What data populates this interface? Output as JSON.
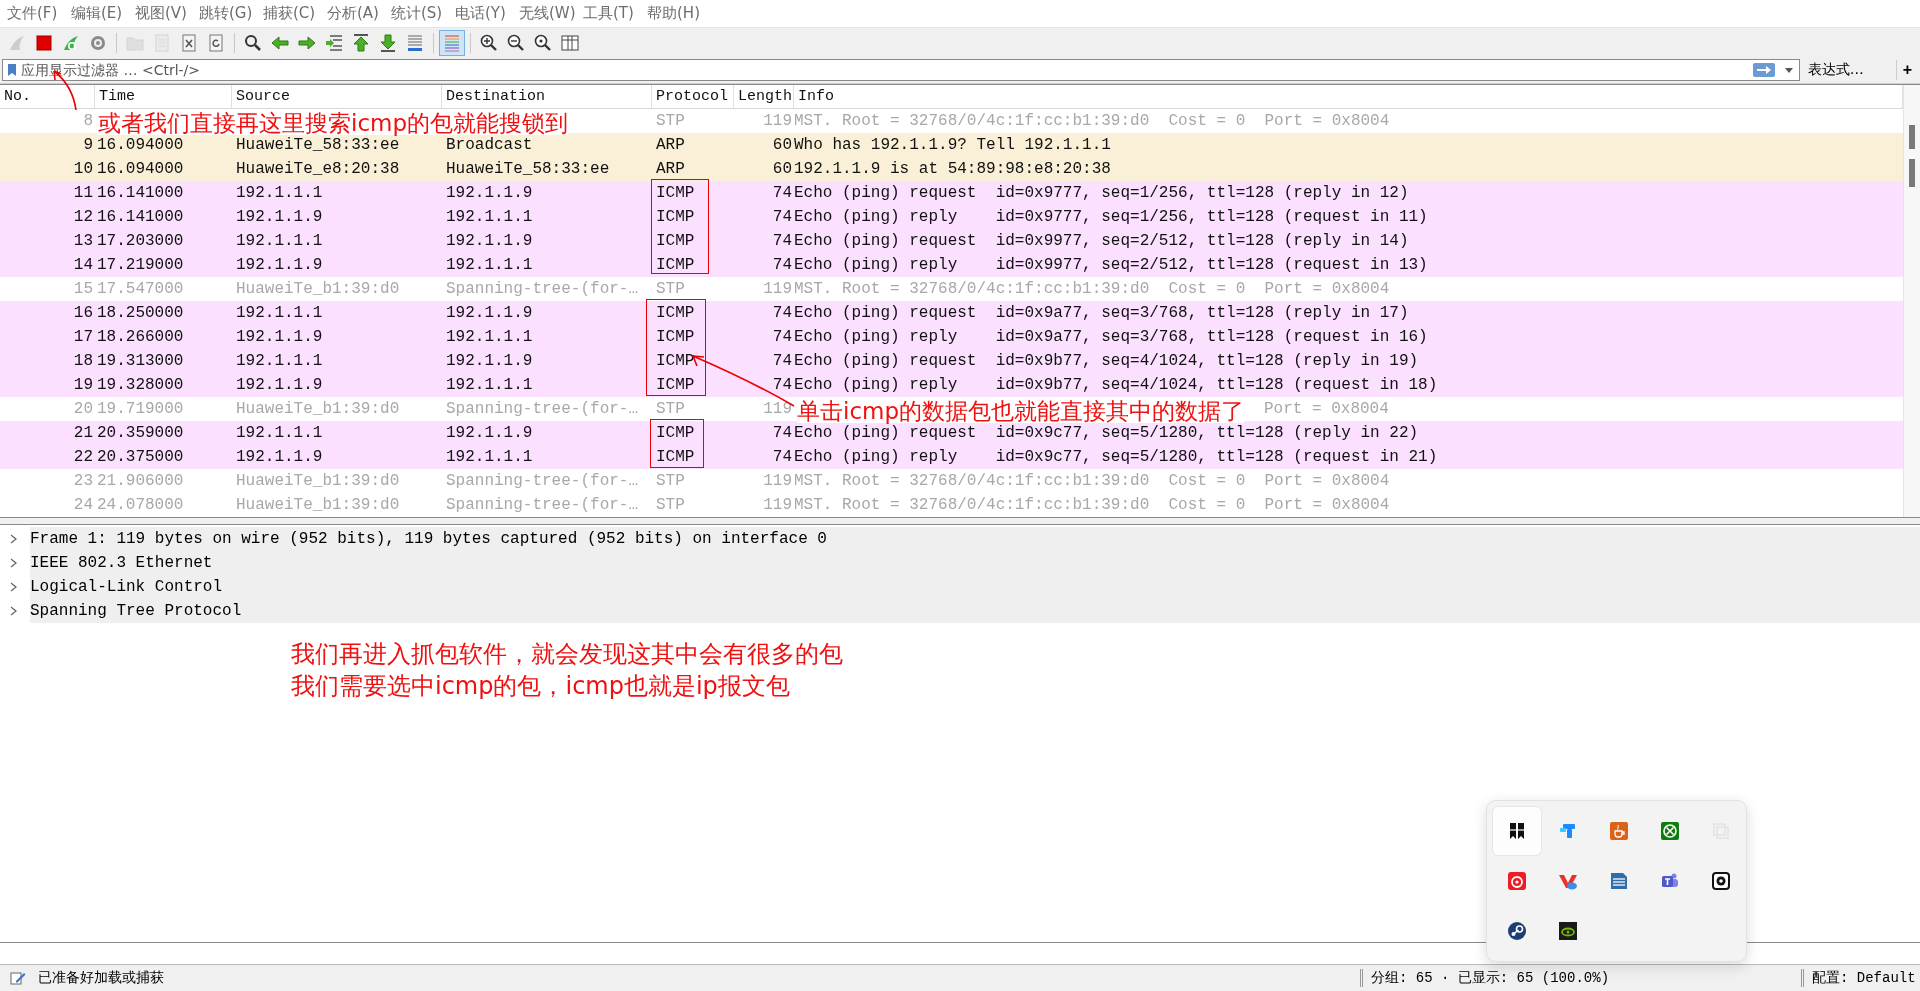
{
  "menu": [
    "文件(F)",
    "编辑(E)",
    "视图(V)",
    "跳转(G)",
    "捕获(C)",
    "分析(A)",
    "统计(S)",
    "电话(Y)",
    "无线(W)",
    "工具(T)",
    "帮助(H)"
  ],
  "toolbar": [
    {
      "kind": "shark-fin",
      "disabled": true,
      "on": false
    },
    {
      "kind": "stop",
      "disabled": false,
      "on": false
    },
    {
      "kind": "restart",
      "disabled": false,
      "on": false
    },
    {
      "kind": "options",
      "disabled": false,
      "on": false
    },
    {
      "kind": "separator"
    },
    {
      "kind": "open",
      "disabled": true,
      "on": false
    },
    {
      "kind": "save",
      "disabled": true,
      "on": false
    },
    {
      "kind": "close",
      "disabled": false,
      "on": false
    },
    {
      "kind": "reload",
      "disabled": false,
      "on": false
    },
    {
      "kind": "separator"
    },
    {
      "kind": "find",
      "disabled": false,
      "on": false
    },
    {
      "kind": "back",
      "disabled": false,
      "on": false
    },
    {
      "kind": "forward",
      "disabled": false,
      "on": false
    },
    {
      "kind": "goto",
      "disabled": false,
      "on": false
    },
    {
      "kind": "first",
      "disabled": false,
      "on": false
    },
    {
      "kind": "last",
      "disabled": false,
      "on": false
    },
    {
      "kind": "autoscroll",
      "disabled": false,
      "on": false
    },
    {
      "kind": "separator"
    },
    {
      "kind": "colorize",
      "disabled": false,
      "on": true
    },
    {
      "kind": "separator"
    },
    {
      "kind": "zoom-in",
      "disabled": false,
      "on": false
    },
    {
      "kind": "zoom-out",
      "disabled": false,
      "on": false
    },
    {
      "kind": "zoom-reset",
      "disabled": false,
      "on": false
    },
    {
      "kind": "resize",
      "disabled": false,
      "on": false
    }
  ],
  "filter": {
    "placeholder": "应用显示过滤器 … <Ctrl-/>",
    "expression_button": "表达式…",
    "add_button": "+"
  },
  "packet_list": {
    "columns": [
      "No.",
      "Time",
      "Source",
      "Destination",
      "Protocol",
      "Length",
      "Info"
    ],
    "rows": [
      {
        "no": "8",
        "protocol": "STP",
        "length": "119",
        "info": "MST. Root = 32768/0/4c:1f:cc:b1:39:d0  Cost = 0  Port = 0x8004",
        "color": "#ffffff",
        "dimmed": true
      },
      {
        "no": "9",
        "time": "16.094000",
        "source": "HuaweiTe_58:33:ee",
        "destination": "Broadcast",
        "protocol": "ARP",
        "length": "60",
        "info": "Who has 192.1.1.9? Tell 192.1.1.1",
        "color": "#faf0d7",
        "dimmed": false
      },
      {
        "no": "10",
        "time": "16.094000",
        "source": "HuaweiTe_e8:20:38",
        "destination": "HuaweiTe_58:33:ee",
        "protocol": "ARP",
        "length": "60",
        "info": "192.1.1.9 is at 54:89:98:e8:20:38",
        "color": "#faf0d7",
        "dimmed": false
      },
      {
        "no": "11",
        "time": "16.141000",
        "source": "192.1.1.1",
        "destination": "192.1.1.9",
        "protocol": "ICMP",
        "length": "74",
        "info": "Echo (ping) request  id=0x9777, seq=1/256, ttl=128 (reply in 12)",
        "color": "#fce0ff",
        "dimmed": false
      },
      {
        "no": "12",
        "time": "16.141000",
        "source": "192.1.1.9",
        "destination": "192.1.1.1",
        "protocol": "ICMP",
        "length": "74",
        "info": "Echo (ping) reply    id=0x9777, seq=1/256, ttl=128 (request in 11)",
        "color": "#fce0ff",
        "dimmed": false
      },
      {
        "no": "13",
        "time": "17.203000",
        "source": "192.1.1.1",
        "destination": "192.1.1.9",
        "protocol": "ICMP",
        "length": "74",
        "info": "Echo (ping) request  id=0x9977, seq=2/512, ttl=128 (reply in 14)",
        "color": "#fce0ff",
        "dimmed": false
      },
      {
        "no": "14",
        "time": "17.219000",
        "source": "192.1.1.9",
        "destination": "192.1.1.1",
        "protocol": "ICMP",
        "length": "74",
        "info": "Echo (ping) reply    id=0x9977, seq=2/512, ttl=128 (request in 13)",
        "color": "#fce0ff",
        "dimmed": false
      },
      {
        "no": "15",
        "time": "17.547000",
        "source": "HuaweiTe_b1:39:d0",
        "destination": "Spanning-tree-(for-…",
        "protocol": "STP",
        "length": "119",
        "info": "MST. Root = 32768/0/4c:1f:cc:b1:39:d0  Cost = 0  Port = 0x8004",
        "color": "#ffffff",
        "dimmed": true
      },
      {
        "no": "16",
        "time": "18.250000",
        "source": "192.1.1.1",
        "destination": "192.1.1.9",
        "protocol": "ICMP",
        "length": "74",
        "info": "Echo (ping) request  id=0x9a77, seq=3/768, ttl=128 (reply in 17)",
        "color": "#fce0ff",
        "dimmed": false
      },
      {
        "no": "17",
        "time": "18.266000",
        "source": "192.1.1.9",
        "destination": "192.1.1.1",
        "protocol": "ICMP",
        "length": "74",
        "info": "Echo (ping) reply    id=0x9a77, seq=3/768, ttl=128 (request in 16)",
        "color": "#fce0ff",
        "dimmed": false
      },
      {
        "no": "18",
        "time": "19.313000",
        "source": "192.1.1.1",
        "destination": "192.1.1.9",
        "protocol": "ICMP",
        "length": "74",
        "info": "Echo (ping) request  id=0x9b77, seq=4/1024, ttl=128 (reply in 19)",
        "color": "#fce0ff",
        "dimmed": false
      },
      {
        "no": "19",
        "time": "19.328000",
        "source": "192.1.1.9",
        "destination": "192.1.1.1",
        "protocol": "ICMP",
        "length": "74",
        "info": "Echo (ping) reply    id=0x9b77, seq=4/1024, ttl=128 (request in 18)",
        "color": "#fce0ff",
        "dimmed": false
      },
      {
        "no": "20",
        "time": "19.719000",
        "source": "HuaweiTe_b1:39:d0",
        "destination": "Spanning-tree-(for-…",
        "protocol": "STP",
        "length": "119",
        "info": "Port = 0x8004",
        "color": "#ffffff",
        "dimmed": true
      },
      {
        "no": "21",
        "time": "20.359000",
        "source": "192.1.1.1",
        "destination": "192.1.1.9",
        "protocol": "ICMP",
        "length": "74",
        "info": "Echo (ping) request  id=0x9c77, seq=5/1280, ttl=128 (reply in 22)",
        "color": "#fce0ff",
        "dimmed": false
      },
      {
        "no": "22",
        "time": "20.375000",
        "source": "192.1.1.9",
        "destination": "192.1.1.1",
        "protocol": "ICMP",
        "length": "74",
        "info": "Echo (ping) reply    id=0x9c77, seq=5/1280, ttl=128 (request in 21)",
        "color": "#fce0ff",
        "dimmed": false
      },
      {
        "no": "23",
        "time": "21.906000",
        "source": "HuaweiTe_b1:39:d0",
        "destination": "Spanning-tree-(for-…",
        "protocol": "STP",
        "length": "119",
        "info": "MST. Root = 32768/0/4c:1f:cc:b1:39:d0  Cost = 0  Port = 0x8004",
        "color": "#ffffff",
        "dimmed": true
      },
      {
        "no": "24",
        "time": "24.078000",
        "source": "HuaweiTe_b1:39:d0",
        "destination": "Spanning-tree-(for-…",
        "protocol": "STP",
        "length": "119",
        "info": "MST. Root = 32768/0/4c:1f:cc:b1:39:d0  Cost = 0  Port = 0x8004",
        "color": "#ffffff",
        "dimmed": true
      }
    ]
  },
  "details": [
    {
      "label": "Frame 1: 119 bytes on wire (952 bits), 119 bytes captured (952 bits) on interface 0",
      "expanded": false
    },
    {
      "label": "IEEE 802.3 Ethernet",
      "expanded": false
    },
    {
      "label": "Logical-Link Control",
      "expanded": false
    },
    {
      "label": "Spanning Tree Protocol",
      "expanded": false
    }
  ],
  "annotations": {
    "search_hint": "或者我们直接再这里搜索icmp的包就能搜锁到",
    "click_hint": "单击icmp的数据包也就能直接其中的数据了",
    "notes": [
      "我们再进入抓包软件，就会发现这其中会有很多的包",
      "我们需要选中icmp的包，icmp也就是ip报文包"
    ]
  },
  "tray_popup": {
    "items": [
      {
        "kind": "bookmark",
        "selected": true
      },
      {
        "kind": "blocks",
        "selected": false
      },
      {
        "kind": "cup",
        "selected": false
      },
      {
        "kind": "cross-circle",
        "selected": false
      },
      {
        "kind": "squares",
        "selected": false
      },
      {
        "kind": "swirl",
        "selected": false
      },
      {
        "kind": "v-cloud",
        "selected": false
      },
      {
        "kind": "document",
        "selected": false
      },
      {
        "kind": "people",
        "selected": false
      },
      {
        "kind": "settings",
        "selected": false
      },
      {
        "kind": "disc",
        "selected": false
      },
      {
        "kind": "eye",
        "selected": false
      }
    ]
  },
  "status_bar": {
    "message": "已准备好加载或捕获",
    "packets": "分组: 65 · 已显示: 65 (100.0%)",
    "profile": "配置: Default"
  }
}
